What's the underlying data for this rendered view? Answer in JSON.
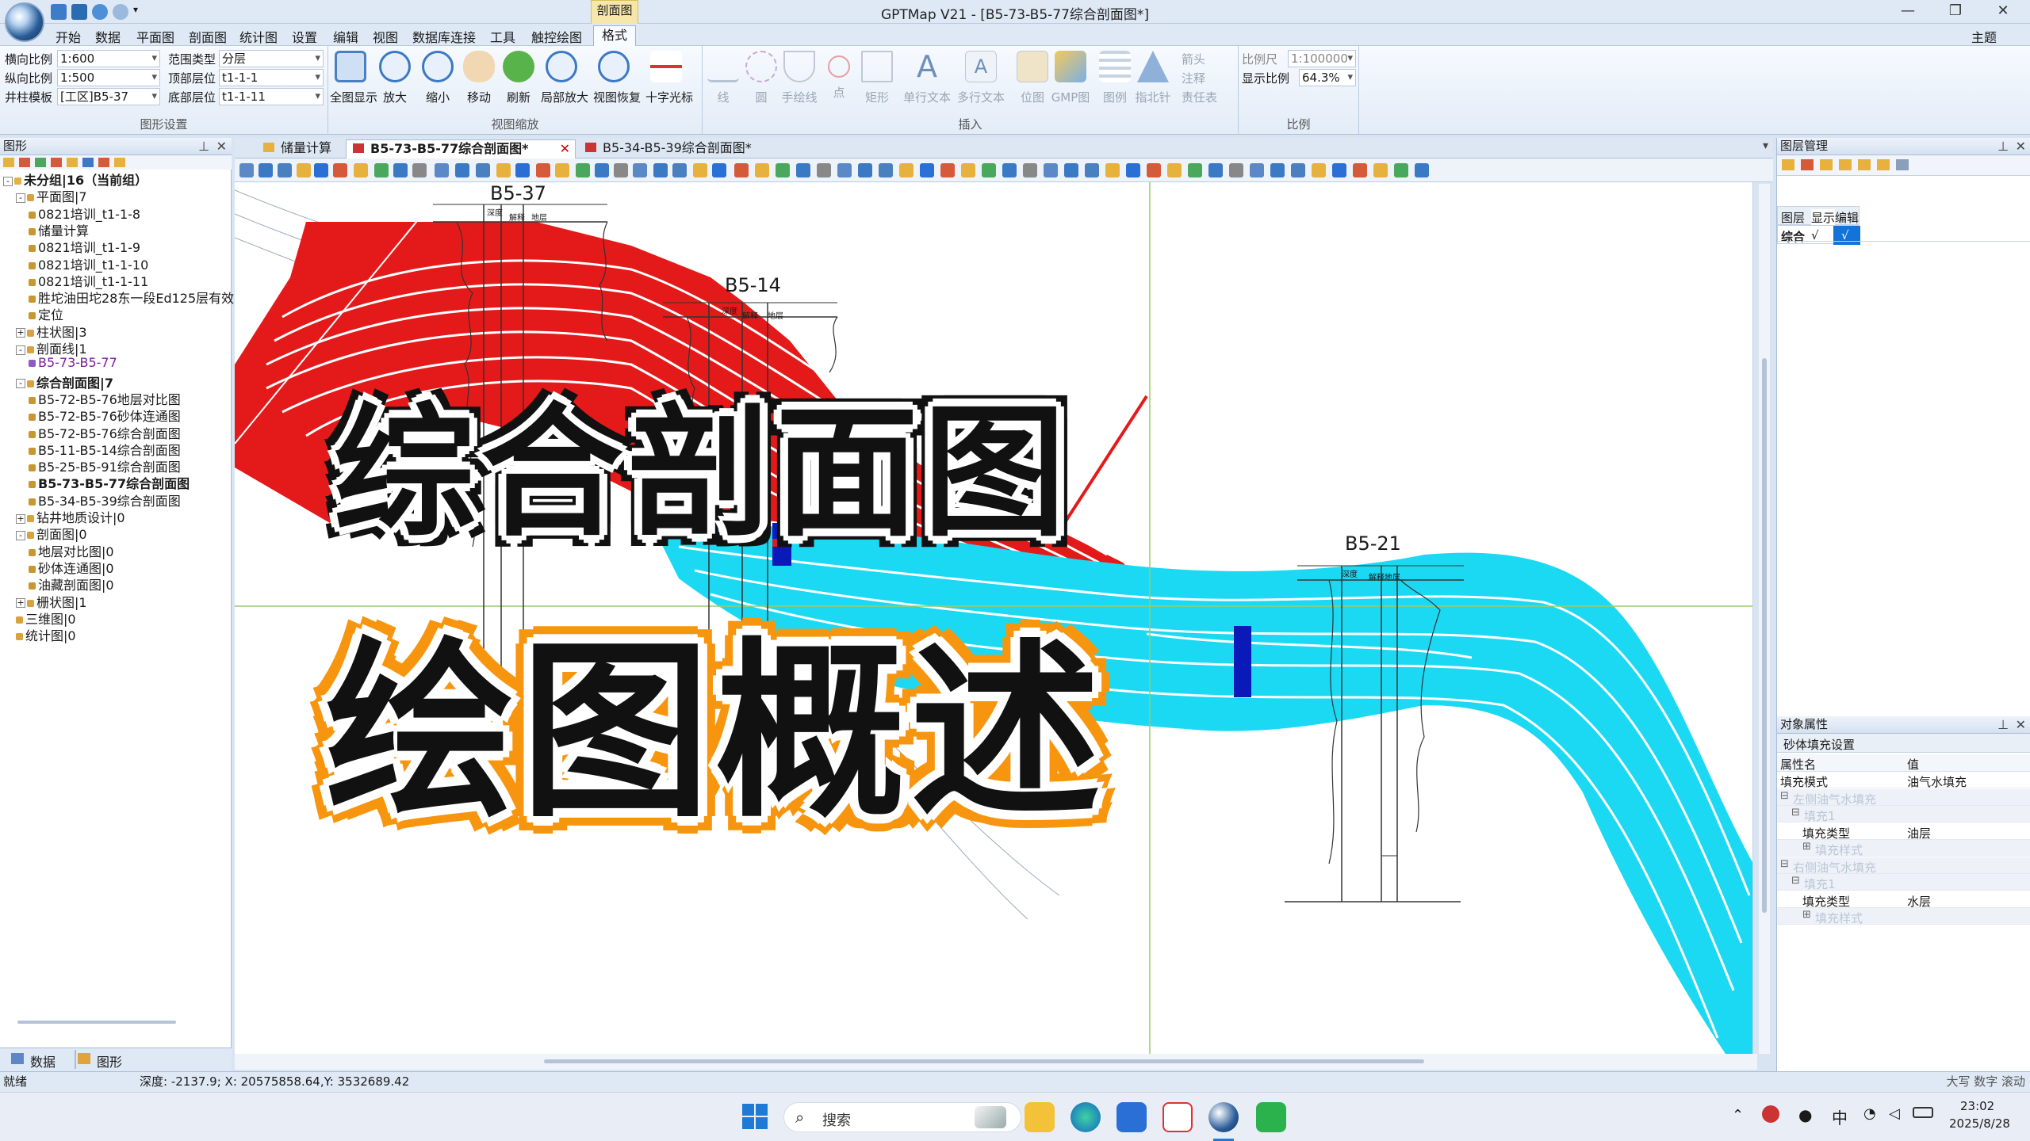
{
  "window": {
    "title": "GPTMap V21 - [B5-73-B5-77综合剖面图*]",
    "context_tab_group": "剖面图",
    "theme_label": "主题"
  },
  "menu": {
    "tabs": [
      "开始",
      "数据",
      "平面图",
      "剖面图",
      "统计图",
      "设置",
      "编辑",
      "视图",
      "数据库连接",
      "工具",
      "触控绘图",
      "格式"
    ],
    "active": "格式"
  },
  "ribbon": {
    "graphics_settings": {
      "label": "图形设置",
      "h_scale_label": "横向比例",
      "h_scale_value": "1:600",
      "v_scale_label": "纵向比例",
      "v_scale_value": "1:500",
      "template_label": "井柱模板",
      "template_value": "[工区]B5-37",
      "range_type_label": "范围类型",
      "range_type_value": "分层",
      "top_layer_label": "顶部层位",
      "top_layer_value": "t1-1-1",
      "bottom_layer_label": "底部层位",
      "bottom_layer_value": "t1-1-11"
    },
    "view_zoom": {
      "label": "视图缩放",
      "buttons": [
        "全图显示",
        "放大",
        "缩小",
        "移动",
        "刷新",
        "局部放大",
        "视图恢复",
        "十字光标"
      ]
    },
    "insert": {
      "label": "插入",
      "buttons": [
        "线",
        "圆",
        "手绘线",
        "点",
        "矩形",
        "单行文本",
        "多行文本",
        "位图",
        "GMP图",
        "图例",
        "指北针"
      ],
      "small": [
        "箭头",
        "注释",
        "责任表"
      ]
    },
    "ratio": {
      "label": "比例",
      "scale_label": "比例尺",
      "scale_value": "1:100000",
      "display_label": "显示比例",
      "display_value": "64.3%"
    }
  },
  "left_panel": {
    "title": "图形",
    "tree": [
      {
        "text": "未分组|16（当前组）",
        "level": 0,
        "bold": true,
        "toggle": "-"
      },
      {
        "text": "平面图|7",
        "level": 1,
        "toggle": "-"
      },
      {
        "text": "0821培训_t1-1-8",
        "level": 2
      },
      {
        "text": "储量计算",
        "level": 2
      },
      {
        "text": "0821培训_t1-1-9",
        "level": 2
      },
      {
        "text": "0821培训_t1-1-10",
        "level": 2
      },
      {
        "text": "0821培训_t1-1-11",
        "level": 2
      },
      {
        "text": "胜坨油田坨28东一段Ed125层有效",
        "level": 2
      },
      {
        "text": "定位",
        "level": 2
      },
      {
        "text": "柱状图|3",
        "level": 1,
        "toggle": "+"
      },
      {
        "text": "剖面线|1",
        "level": 1,
        "toggle": "-"
      },
      {
        "text": "B5-73-B5-77",
        "level": 2,
        "color": "#7a1fa2"
      },
      {
        "text": "综合剖面图|7",
        "level": 1,
        "toggle": "-",
        "bold": true
      },
      {
        "text": "B5-72-B5-76地层对比图",
        "level": 2
      },
      {
        "text": "B5-72-B5-76砂体连通图",
        "level": 2
      },
      {
        "text": "B5-72-B5-76综合剖面图",
        "level": 2
      },
      {
        "text": "B5-11-B5-14综合剖面图",
        "level": 2
      },
      {
        "text": "B5-25-B5-91综合剖面图",
        "level": 2
      },
      {
        "text": "B5-73-B5-77综合剖面图",
        "level": 2,
        "bold": true
      },
      {
        "text": "B5-34-B5-39综合剖面图",
        "level": 2
      },
      {
        "text": "钻井地质设计|0",
        "level": 1,
        "toggle": "+"
      },
      {
        "text": "剖面图|0",
        "level": 1,
        "toggle": "-"
      },
      {
        "text": "地层对比图|0",
        "level": 2
      },
      {
        "text": "砂体连通图|0",
        "level": 2
      },
      {
        "text": "油藏剖面图|0",
        "level": 2
      },
      {
        "text": "栅状图|1",
        "level": 1,
        "toggle": "+"
      },
      {
        "text": "三维图|0",
        "level": 1
      },
      {
        "text": "统计图|0",
        "level": 1
      }
    ],
    "bottom_tabs": [
      "数据",
      "图形"
    ]
  },
  "doc_tabs": [
    "储量计算",
    "B5-73-B5-77综合剖面图*",
    "B5-34-B5-39综合剖面图*"
  ],
  "doc_tab_active": "B5-73-B5-77综合剖面图*",
  "canvas": {
    "wells": [
      "B5-37",
      "B5-14",
      "B5-21"
    ],
    "col_headers": [
      "深度",
      "解释",
      "地层"
    ],
    "headline_1": "综合剖面图",
    "headline_2": "绘图概述"
  },
  "layer_panel": {
    "title": "图层管理",
    "header": [
      "图层",
      "显示",
      "编辑"
    ],
    "rows": [
      {
        "name": "综合",
        "show": "√",
        "edit": "√"
      }
    ]
  },
  "props_panel": {
    "title": "对象属性",
    "subtitle": "砂体填充设置",
    "col_name": "属性名",
    "col_value": "值",
    "rows": [
      {
        "name": "填充模式",
        "value": "油气水填充",
        "level": 0
      },
      {
        "name": "左侧油气水填充",
        "value": "",
        "level": 0,
        "group": true
      },
      {
        "name": "填充1",
        "value": "",
        "level": 1,
        "group": true
      },
      {
        "name": "填充类型",
        "value": "油层",
        "level": 2
      },
      {
        "name": "填充样式",
        "value": "",
        "level": 2,
        "group": true
      },
      {
        "name": "右侧油气水填充",
        "value": "",
        "level": 0,
        "group": true
      },
      {
        "name": "填充1",
        "value": "",
        "level": 1,
        "group": true
      },
      {
        "name": "填充类型",
        "value": "水层",
        "level": 2
      },
      {
        "name": "填充样式",
        "value": "",
        "level": 2,
        "group": true
      }
    ]
  },
  "status": {
    "ready": "就绪",
    "coords": "深度: -2137.9; X: 20575858.64,Y: 3532689.42",
    "right": "大写 数字 滚动"
  },
  "taskbar": {
    "search": "搜索",
    "ime": "中",
    "time": "23:02",
    "date": "2025/8/28"
  },
  "colors": {
    "red_fill": "#e41a1a",
    "cyan_fill": "#1bd9f2",
    "blue_block": "#0a1ab8",
    "headline_fill": "#111111",
    "headline_outline_1": "#ffffff",
    "headline_outline_2": "#f7950f"
  }
}
